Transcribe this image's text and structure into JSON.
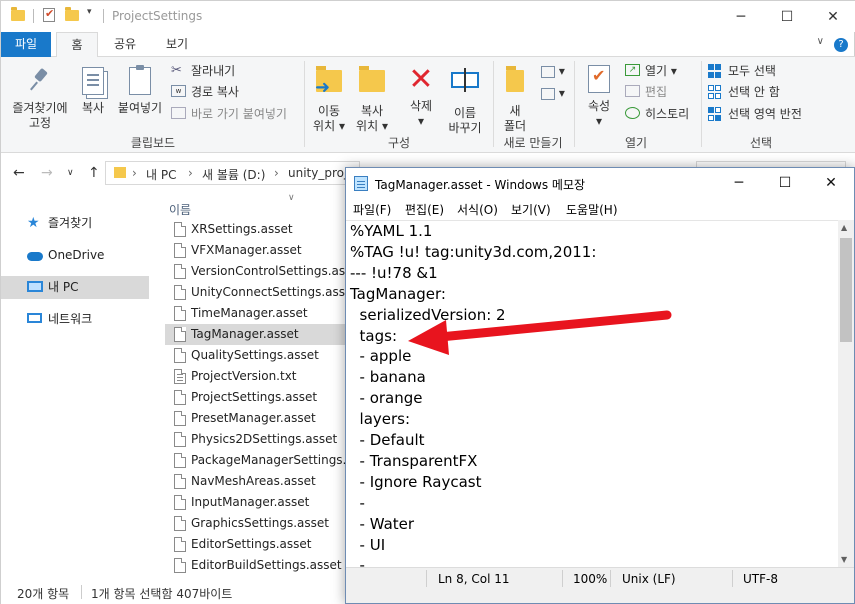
{
  "explorer": {
    "title": "ProjectSettings",
    "ribbon_tabs": [
      "파일",
      "홈",
      "공유",
      "보기"
    ],
    "clipboard": {
      "pin_label_1": "즐겨찾기에",
      "pin_label_2": "고정",
      "copy": "복사",
      "paste": "붙여넣기",
      "cut": "잘라내기",
      "copy_path": "경로 복사",
      "paste_shortcut": "바로 가기 붙여넣기",
      "group": "클립보드"
    },
    "organize": {
      "move_1": "이동",
      "move_2": "위치",
      "copyto_1": "복사",
      "copyto_2": "위치",
      "delete": "삭제",
      "rename_1": "이름",
      "rename_2": "바꾸기",
      "group": "구성"
    },
    "new": {
      "folder_1": "새",
      "folder_2": "폴더",
      "group": "새로 만들기"
    },
    "open": {
      "properties": "속성",
      "open": "열기",
      "edit": "편집",
      "history": "히스토리",
      "group": "열기"
    },
    "select": {
      "all": "모두 선택",
      "none": "선택 안 함",
      "invert": "선택 영역 반전",
      "group": "선택"
    },
    "breadcrumb": [
      "내 PC",
      "새 볼륨 (D:)",
      "unity_proje"
    ],
    "sidebar": [
      {
        "label": "즐겨찾기",
        "icon": "star-icon"
      },
      {
        "label": "OneDrive",
        "icon": "cloud-icon"
      },
      {
        "label": "내 PC",
        "icon": "computer-icon"
      },
      {
        "label": "네트워크",
        "icon": "network-icon"
      }
    ],
    "column_name": "이름",
    "files": [
      "XRSettings.asset",
      "VFXManager.asset",
      "VersionControlSettings.asset",
      "UnityConnectSettings.asset",
      "TimeManager.asset",
      "TagManager.asset",
      "QualitySettings.asset",
      "ProjectVersion.txt",
      "ProjectSettings.asset",
      "PresetManager.asset",
      "Physics2DSettings.asset",
      "PackageManagerSettings.asse",
      "NavMeshAreas.asset",
      "InputManager.asset",
      "GraphicsSettings.asset",
      "EditorSettings.asset",
      "EditorBuildSettings.asset"
    ],
    "selected_file": "TagManager.asset",
    "status_count": "20개 항목",
    "status_selection": "1개 항목 선택함 407바이트"
  },
  "notepad": {
    "title": "TagManager.asset - Windows 메모장",
    "menu": [
      "파일(F)",
      "편집(E)",
      "서식(O)",
      "보기(V)",
      "도움말(H)"
    ],
    "lines": [
      "%YAML 1.1",
      "%TAG !u! tag:unity3d.com,2011:",
      "--- !u!78 &1",
      "TagManager:",
      "  serializedVersion: 2",
      "  tags:",
      "  - apple",
      "  - banana",
      "  - orange",
      "  layers:",
      "  - Default",
      "  - TransparentFX",
      "  - Ignore Raycast",
      "  -",
      "  - Water",
      "  - UI",
      "  -"
    ],
    "status": {
      "position": "Ln 8, Col 11",
      "zoom": "100%",
      "line_ending": "Unix (LF)",
      "encoding": "UTF-8"
    }
  },
  "colors": {
    "accent": "#1979ca",
    "annotation_arrow": "#e8141e"
  }
}
